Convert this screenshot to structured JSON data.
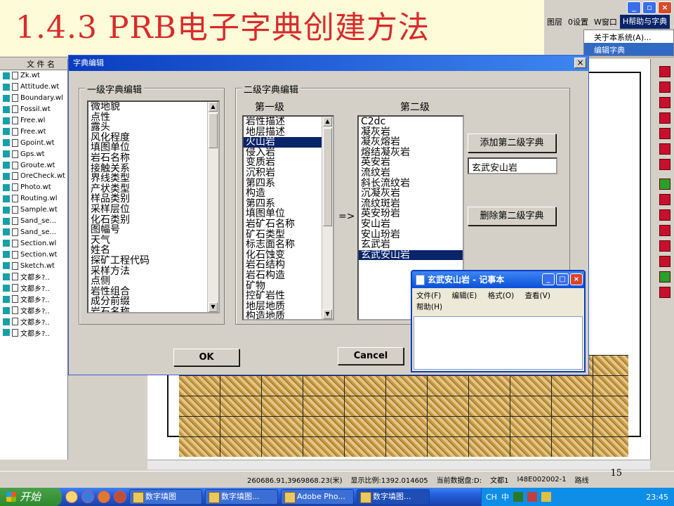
{
  "slide_title": "1.4.3 PRB电子字典创建方法",
  "menubar": {
    "items": [
      "图层",
      "0设置",
      "W窗口",
      "H帮助与字典"
    ]
  },
  "help_menu": {
    "items": [
      "关于本系统(A)...",
      "编辑字典"
    ],
    "highlighted": "编辑字典"
  },
  "file_panel": {
    "header": "文 件 名",
    "files": [
      "Zk.wt",
      "Attitude.wt",
      "Boundary.wl",
      "Fossil.wt",
      "Free.wl",
      "Free.wt",
      "Gpoint.wt",
      "Gps.wt",
      "Groute.wt",
      "OreCheck.wt",
      "Photo.wt",
      "Routing.wl",
      "Sample.wt",
      "Sand_se...",
      "Sand_se...",
      "Section.wl",
      "Section.wt",
      "Sketch.wt",
      "文都乡?..",
      "文都乡?..",
      "文都乡?..",
      "文都乡?..",
      "文都乡?..",
      "文都乡?.."
    ]
  },
  "dialog": {
    "title": "字典编辑",
    "close": "×",
    "level1": {
      "group_title": "一级字典编辑",
      "items": [
        "微地貌",
        "点性",
        "露头",
        "风化程度",
        "填图单位",
        "岩石名称",
        "接触关系",
        "界线类型",
        "产状类型",
        "样品类别",
        "采样层位",
        "化石类别",
        "图幅号",
        "天气",
        "姓名",
        "探矿工程代码",
        "采样方法",
        "点侧",
        "岩性组合",
        "成分前缀",
        "岩石名称"
      ]
    },
    "level2": {
      "group_title": "二级字典编辑",
      "first_label": "第一级",
      "second_label": "第二级",
      "first_items": [
        "岩性描述",
        "地层描述",
        "火山岩",
        "侵入岩",
        "变质岩",
        "沉积岩",
        "第四系",
        "构造",
        "第四系",
        "填图单位",
        "岩矿石名称",
        "矿石类型",
        "标志面名称",
        "化石蚀变",
        "岩石结构",
        "岩石构造",
        "矿物",
        "控矿岩性",
        "地层地质",
        "构造地质"
      ],
      "first_selected": "火山岩",
      "arrow": "=>",
      "second_items": [
        "C2dc",
        "凝灰岩",
        "凝灰熔岩",
        "熔结凝灰岩",
        "英安岩",
        "流纹岩",
        "斜长流纹岩",
        "沉凝灰岩",
        "流纹斑岩",
        "英安玢岩",
        "安山岩",
        "安山玢岩",
        "玄武岩",
        "玄武安山岩"
      ],
      "second_selected": "玄武安山岩",
      "add_button": "添加第二级字典",
      "input_value": "玄武安山岩",
      "delete_button": "删除第二级字典"
    },
    "ok": "OK",
    "cancel": "Cancel"
  },
  "notepad": {
    "title": "玄武安山岩 - 记事本",
    "menu": [
      "文件(F)",
      "编辑(E)",
      "格式(O)",
      "查看(V)",
      "帮助(H)"
    ],
    "minimize": "_",
    "maximize": "□",
    "close": "×"
  },
  "statusbar": {
    "coords": "260686.91,3969868.23(米)",
    "scale": "显示比例:1392.014605",
    "disk": "当前数据盘:D:",
    "doc": "文都1",
    "sheet": "I48E002002-1",
    "route": "路线"
  },
  "page_number": "15",
  "taskbar": {
    "start": "开始",
    "tasks": [
      "数字填图",
      "数字填图...",
      "Adobe Pho...",
      "数字填图..."
    ],
    "tray_lang": "CH",
    "tray_ime": "中",
    "time": "23:45"
  }
}
